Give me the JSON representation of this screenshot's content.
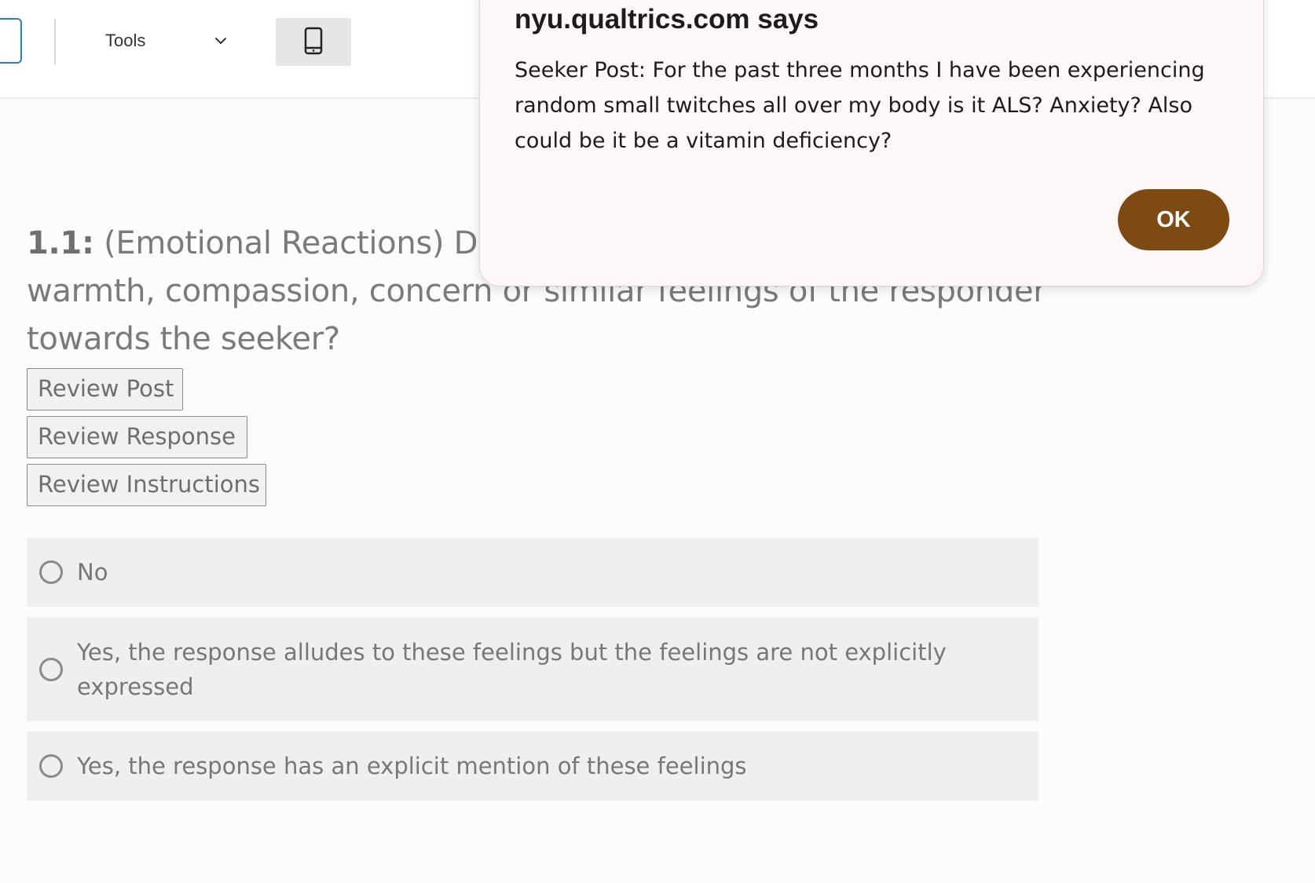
{
  "toolbar": {
    "tools_label": "Tools",
    "tools_icon": "chevron-down-icon",
    "mobile_icon": "mobile-phone-icon"
  },
  "question": {
    "number": "1.1:",
    "line1": "(Emotional Reactions) Do",
    "line2": "warmth, compassion, concern or similar feelings of the responder",
    "line3": "towards the seeker?"
  },
  "buttons": {
    "review_post": "Review Post",
    "review_response": "Review Response",
    "review_instructions": "Review Instructions"
  },
  "choices": [
    {
      "label": "No",
      "selected": false
    },
    {
      "label": "Yes, the response alludes to these feelings but the feelings are not explicitly expressed",
      "selected": false
    },
    {
      "label": "Yes, the response has an explicit mention of these feelings",
      "selected": false
    }
  ],
  "dialog": {
    "title": "nyu.qualtrics.com says",
    "message": "Seeker Post: For the past three months I have been experiencing random small twitches all over my body is it ALS? Anxiety? Also could be it be a vitamin deficiency?",
    "ok_label": "OK",
    "ok_color": "#7c4a12"
  }
}
